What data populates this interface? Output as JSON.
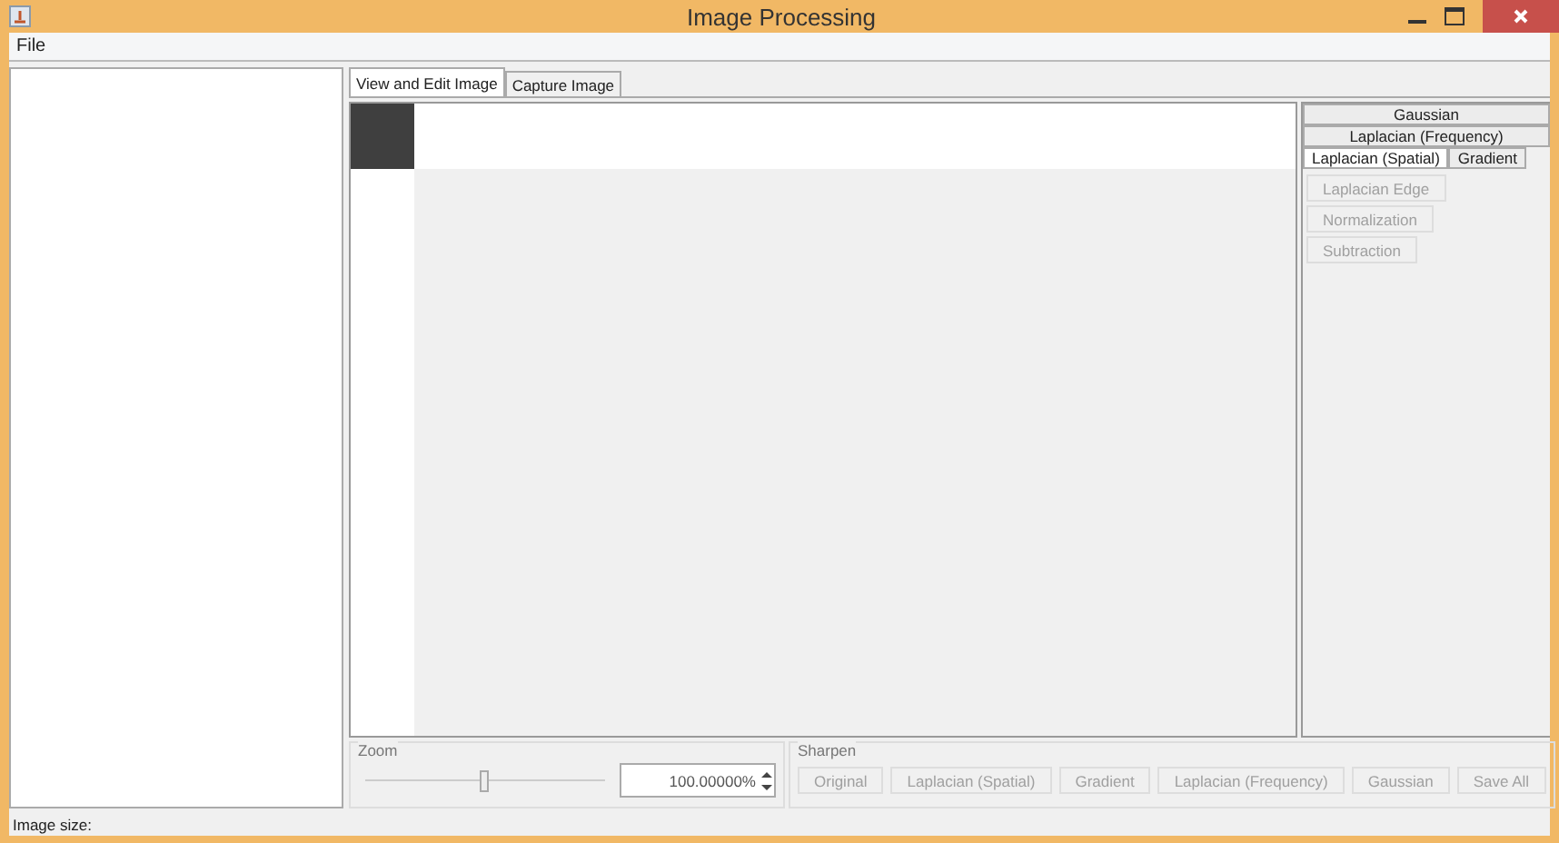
{
  "window": {
    "title": "Image Processing"
  },
  "menu": [
    "File"
  ],
  "tabs": [
    {
      "label": "View and Edit Image",
      "selected": true
    },
    {
      "label": "Capture Image",
      "selected": false
    }
  ],
  "filter_tabs": [
    {
      "tabs": [
        {
          "label": "Gaussian",
          "selected": false
        }
      ]
    },
    {
      "tabs": [
        {
          "label": "Laplacian (Frequency)",
          "selected": false
        }
      ]
    },
    {
      "tabs": [
        {
          "label": "Laplacian (Spatial)",
          "selected": true
        },
        {
          "label": "Gradient",
          "selected": false
        }
      ]
    }
  ],
  "filter_buttons": [
    {
      "label": "Laplacian Edge",
      "disabled": true
    },
    {
      "label": "Normalization",
      "disabled": true
    },
    {
      "label": "Subtraction",
      "disabled": true
    }
  ],
  "zoom": {
    "label": "Zoom",
    "level": 0.5,
    "value": "100.00000%"
  },
  "sharpen": {
    "label": "Sharpen",
    "buttons": [
      {
        "label": "Original",
        "disabled": true
      },
      {
        "label": "Laplacian (Spatial)",
        "disabled": true
      },
      {
        "label": "Gradient",
        "disabled": true
      },
      {
        "label": "Laplacian (Frequency)",
        "disabled": true
      },
      {
        "label": "Gaussian",
        "disabled": true
      },
      {
        "label": "Save All",
        "disabled": true
      }
    ]
  },
  "status_bar": "Image size:"
}
